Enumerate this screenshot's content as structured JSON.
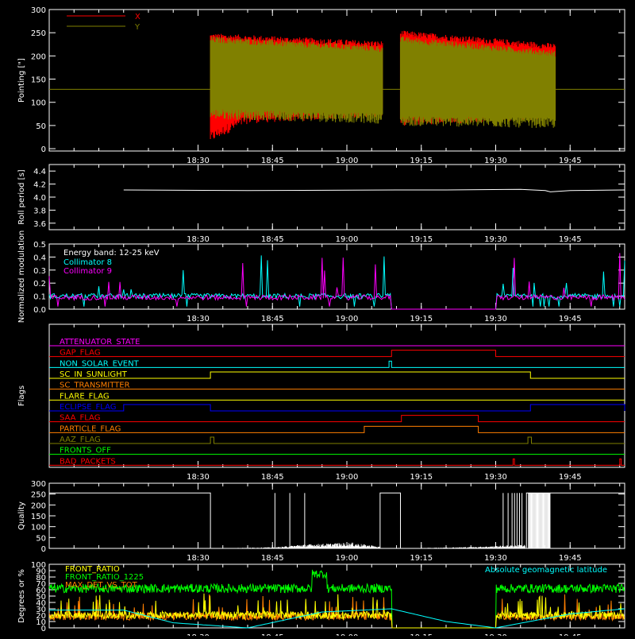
{
  "colors": {
    "background": "#000000",
    "axes": "#ffffff",
    "red": "#ff0000",
    "olive": "#808000",
    "cyan": "#00ffff",
    "magenta": "#ff00ff",
    "green": "#00ff00",
    "orange": "#ff7f00",
    "yellow": "#ffff00",
    "blue": "#0000ff",
    "white": "#ffffff"
  },
  "time_axis": {
    "range_min": [
      1095,
      1185
    ],
    "tick_minutes": [
      1110,
      1125,
      1140,
      1155,
      1170,
      1185
    ],
    "tick_labels": [
      "18:30",
      "18:45",
      "19:00",
      "19:15",
      "19:30",
      "19:45"
    ]
  },
  "chart_data": [
    {
      "id": "pointing",
      "type": "line",
      "title": "",
      "xlabel": "",
      "ylabel": "Pointing [\"]",
      "ylim": [
        -5,
        300
      ],
      "yticks": [
        0,
        50,
        100,
        150,
        200,
        250,
        300
      ],
      "legend_placement": "top-left",
      "series": [
        {
          "name": "X",
          "color": "#ff0000",
          "segments": [
            [
              1112.5,
              1147.2
            ],
            [
              1150.8,
              1182.0
            ]
          ],
          "upper": [
            [
              1112.5,
              242
            ],
            [
              1147.2,
              225
            ],
            [
              1150.8,
              248
            ],
            [
              1182.0,
              220
            ]
          ],
          "lower": [
            [
              1112.5,
              25
            ],
            [
              1120,
              65
            ],
            [
              1147.2,
              80
            ],
            [
              1150.8,
              60
            ],
            [
              1182.0,
              75
            ]
          ],
          "flat_value": 128
        },
        {
          "name": "Y",
          "color": "#808000",
          "segments": [
            [
              1112.5,
              1147.2
            ],
            [
              1150.8,
              1182.0
            ]
          ],
          "upper": [
            [
              1112.5,
              235
            ],
            [
              1147.2,
              215
            ],
            [
              1150.8,
              235
            ],
            [
              1182.0,
              205
            ]
          ],
          "lower": [
            [
              1112.5,
              75
            ],
            [
              1147.2,
              65
            ],
            [
              1150.8,
              60
            ],
            [
              1182.0,
              55
            ]
          ],
          "flat_value": 128
        }
      ]
    },
    {
      "id": "roll_period",
      "type": "line",
      "title": "",
      "xlabel": "",
      "ylabel": "Roll period [s]",
      "ylim": [
        3.5,
        4.5
      ],
      "yticks": [
        3.6,
        3.8,
        4.0,
        4.2,
        4.4
      ],
      "series": [
        {
          "name": "",
          "color": "#ffffff",
          "x": [
            1095,
            1120,
            1150,
            1160,
            1175,
            1180,
            1181,
            1185,
            1196
          ],
          "y": [
            4.11,
            4.1,
            4.11,
            4.11,
            4.12,
            4.1,
            4.08,
            4.1,
            4.11
          ]
        }
      ]
    },
    {
      "id": "modulation",
      "type": "line",
      "title": "",
      "xlabel": "",
      "ylabel": "Normalized modulation",
      "ylim": [
        0,
        0.5
      ],
      "yticks": [
        0.0,
        0.1,
        0.2,
        0.3,
        0.4,
        0.5
      ],
      "legend_placement": "top-left",
      "annotation": "Energy band: 12-25 keV",
      "off_interval": [
        1149,
        1170
      ],
      "series": [
        {
          "name": "Collimator 8",
          "color": "#00ffff",
          "baseline": 0.1
        },
        {
          "name": "Collimator 9",
          "color": "#ff00ff",
          "baseline": 0.09
        }
      ]
    },
    {
      "id": "flags",
      "type": "line",
      "title": "",
      "xlabel": "",
      "ylabel": "Flags",
      "flags": [
        {
          "name": "ATTENUATOR_STATE",
          "color": "#ff00ff",
          "on": []
        },
        {
          "name": "GAP_FLAG",
          "color": "#ff0000",
          "on": [
            [
              1149,
              1170
            ]
          ]
        },
        {
          "name": "NON_SOLAR_EVENT",
          "color": "#00ffff",
          "on": [
            [
              1148.5,
              1149
            ]
          ]
        },
        {
          "name": "SC_IN_SUNLIGHT",
          "color": "#ffff00",
          "on": [
            [
              1112.5,
              1177
            ]
          ]
        },
        {
          "name": "SC_TRANSMITTER",
          "color": "#ff7f00",
          "on": []
        },
        {
          "name": "FLARE_FLAG",
          "color": "#ffff00",
          "on": []
        },
        {
          "name": "ECLIPSE_FLAG",
          "color": "#0000ff",
          "on": [
            [
              1095,
              1112.5
            ],
            [
              1177,
              1196
            ]
          ]
        },
        {
          "name": "SAA_FLAG",
          "color": "#ff0000",
          "on": [
            [
              1151,
              1166.5
            ]
          ]
        },
        {
          "name": "PARTICLE_FLAG",
          "color": "#ff7f00",
          "on": [
            [
              1143.5,
              1166.5
            ]
          ]
        },
        {
          "name": "AAZ_FLAG",
          "color": "#808000",
          "on": [
            [
              1112.5,
              1113.2
            ],
            [
              1176.5,
              1177.2
            ]
          ]
        },
        {
          "name": "FRONTS_OFF",
          "color": "#00ff00",
          "on": []
        },
        {
          "name": "BAD_PACKETS",
          "color": "#ff0000",
          "on": [
            [
              1173.5,
              1173.8
            ],
            [
              1195,
              1195.3
            ]
          ]
        }
      ]
    },
    {
      "id": "quality",
      "type": "line",
      "title": "",
      "xlabel": "",
      "ylabel": "Quality",
      "ylim": [
        0,
        300
      ],
      "yticks": [
        0,
        50,
        100,
        150,
        200,
        250,
        300
      ],
      "series": [
        {
          "name": "",
          "color": "#ffffff",
          "high_intervals": [
            [
              1095,
              1112.5
            ],
            [
              1146.7,
              1150.8
            ],
            [
              1176.2,
              1196
            ]
          ],
          "spikes": [
            1125.5,
            1128.5,
            1131.5,
            1171.5,
            1172.5,
            1173.3,
            1173.8,
            1174.3,
            1174.8,
            1175.3
          ],
          "ramp": [
            [
              1112.5,
              0
            ],
            [
              1126,
              4
            ],
            [
              1131,
              12
            ],
            [
              1141,
              18
            ],
            [
              1146.7,
              5
            ],
            [
              1150.8,
              0
            ],
            [
              1166,
              5
            ],
            [
              1176,
              12
            ]
          ],
          "high_value": 255
        }
      ]
    },
    {
      "id": "geomag",
      "type": "line",
      "title": "",
      "xlabel": "",
      "ylabel": "Degrees or %",
      "ylim": [
        0,
        100
      ],
      "yticks": [
        0,
        10,
        20,
        30,
        40,
        50,
        60,
        70,
        80,
        90,
        100
      ],
      "legend_placement": "top-left",
      "off_interval": [
        1149,
        1170
      ],
      "series": [
        {
          "name": "FRONT_RATIO",
          "color": "#ffff00",
          "baseline": 20
        },
        {
          "name": "FRONT_RATIO_1225",
          "color": "#00ff00",
          "baseline": 62,
          "bump": [
            1133,
            1136,
            85
          ]
        },
        {
          "name": "MAX_DET_VS_TOT",
          "color": "#ff7f00",
          "baseline": 18
        },
        {
          "name": "Absolute geomagnetic latitude",
          "color": "#00ffff",
          "x": [
            1095,
            1105,
            1120,
            1135,
            1149,
            1160,
            1170,
            1185,
            1196
          ],
          "y": [
            28,
            8,
            0,
            25,
            30,
            10,
            0,
            22,
            30
          ]
        }
      ]
    }
  ]
}
